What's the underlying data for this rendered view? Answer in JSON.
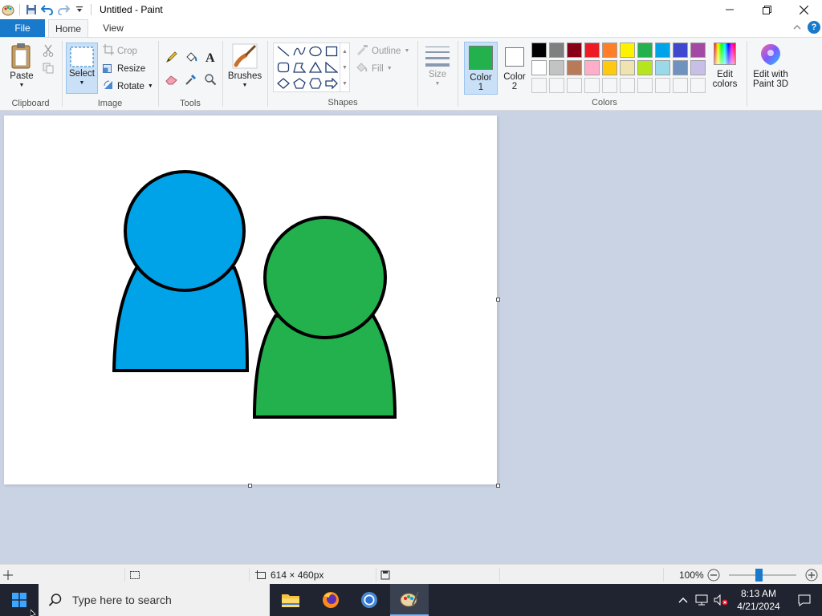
{
  "window": {
    "title": "Untitled - Paint"
  },
  "tabs": {
    "file": "File",
    "home": "Home",
    "view": "View"
  },
  "ribbon": {
    "clipboard": {
      "label": "Clipboard",
      "paste": "Paste"
    },
    "image": {
      "label": "Image",
      "select": "Select",
      "crop": "Crop",
      "resize": "Resize",
      "rotate": "Rotate"
    },
    "tools": {
      "label": "Tools"
    },
    "brushes": {
      "label": "Brushes"
    },
    "shapes": {
      "label": "Shapes",
      "outline": "Outline",
      "fill": "Fill"
    },
    "size": {
      "label": "Size"
    },
    "colors": {
      "label": "Colors",
      "color1": "Color",
      "color1_num": "1",
      "color2": "Color",
      "color2_num": "2",
      "color1_value": "#22b14c",
      "color2_value": "#ffffff",
      "edit_colors_1": "Edit",
      "edit_colors_2": "colors",
      "paint3d_1": "Edit with",
      "paint3d_2": "Paint 3D",
      "palette_row1": [
        "#000000",
        "#7f7f7f",
        "#880015",
        "#ed1c24",
        "#ff7f27",
        "#fff200",
        "#22b14c",
        "#00a2e8",
        "#3f48cc",
        "#a349a4"
      ],
      "palette_row2": [
        "#ffffff",
        "#c3c3c3",
        "#b97a57",
        "#ffaec9",
        "#ffc90e",
        "#efe4b0",
        "#b5e61d",
        "#99d9ea",
        "#7092be",
        "#c8bfe7"
      ]
    }
  },
  "canvas": {
    "figures": [
      {
        "name": "blue-person",
        "color": "#00a2e8"
      },
      {
        "name": "green-person",
        "color": "#22b14c"
      }
    ]
  },
  "statusbar": {
    "dimensions": "614 × 460px",
    "zoom": "100%",
    "zoom_level": 1.0
  },
  "taskbar": {
    "search_placeholder": "Type here to search",
    "time": "8:13 AM",
    "date": "4/21/2024"
  }
}
